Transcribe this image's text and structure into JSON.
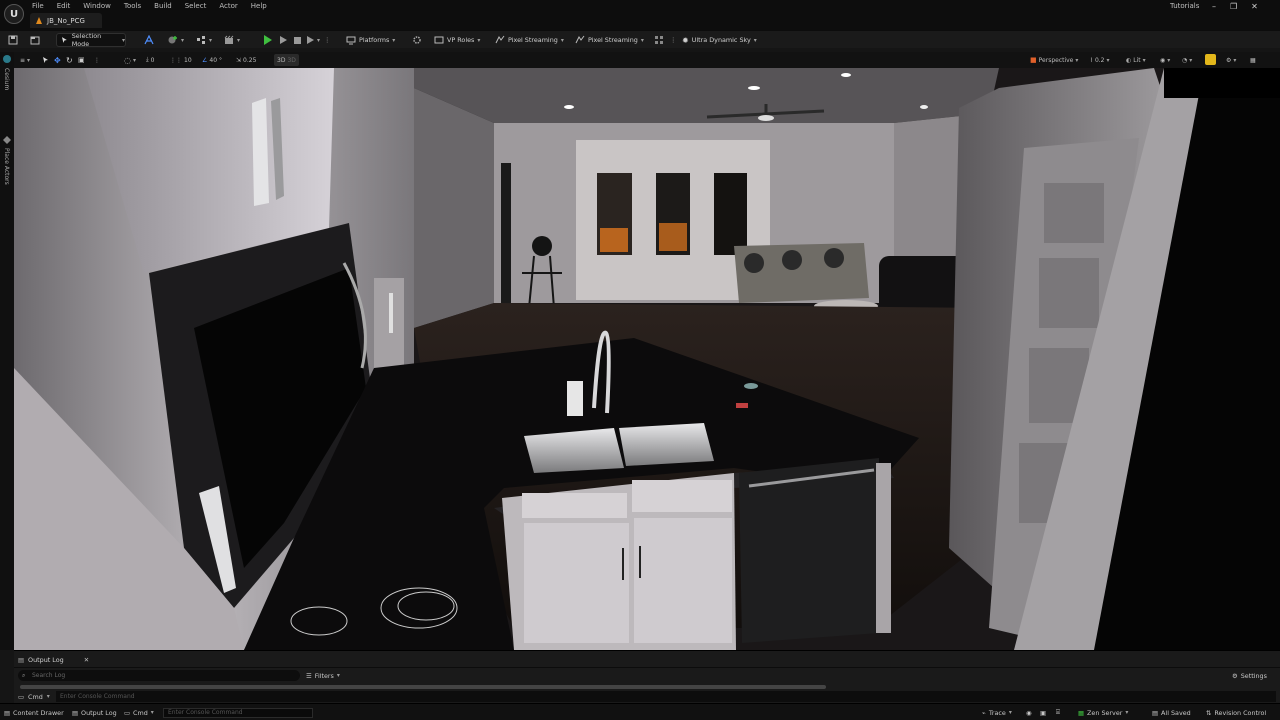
{
  "menu": {
    "items": [
      "File",
      "Edit",
      "Window",
      "Tools",
      "Build",
      "Select",
      "Actor",
      "Help"
    ]
  },
  "tab": {
    "label": "JB_No_PCG"
  },
  "title_right": {
    "tutorials": "Tutorials"
  },
  "toolbar": {
    "mode": "Selection Mode",
    "platforms": "Platforms",
    "vp_roles": "VP Roles",
    "pixel_streaming_1": "Pixel Streaming",
    "pixel_streaming_2": "Pixel Streaming",
    "sky": "Ultra Dynamic Sky"
  },
  "viewport_toolbar": {
    "rot_snap": "0",
    "grid_snap": "10",
    "angle_snap": "40",
    "scale_snap": "0.25",
    "mode_3d": "3D",
    "view_mode": "Perspective",
    "fov": "0.2",
    "lighting": "Lit"
  },
  "side_tabs": [
    "Cesium",
    "Place Actors"
  ],
  "output_log": {
    "tab_label": "Output Log",
    "search_placeholder": "Search Log",
    "filters": "Filters",
    "settings": "Settings",
    "cmd": "Cmd",
    "console_placeholder": "Enter Console Command"
  },
  "status_bar": {
    "content_drawer": "Content Drawer",
    "output_log": "Output Log",
    "cmd": "Cmd",
    "console_placeholder": "Enter Console Command",
    "trace": "Trace",
    "zen_server": "Zen Server",
    "all_saved": "All Saved",
    "revision_control": "Revision Control"
  },
  "colors": {
    "play_green": "#3fbf3f",
    "accent_yellow": "#e3b71b",
    "tab_orange": "#e08a1e"
  }
}
